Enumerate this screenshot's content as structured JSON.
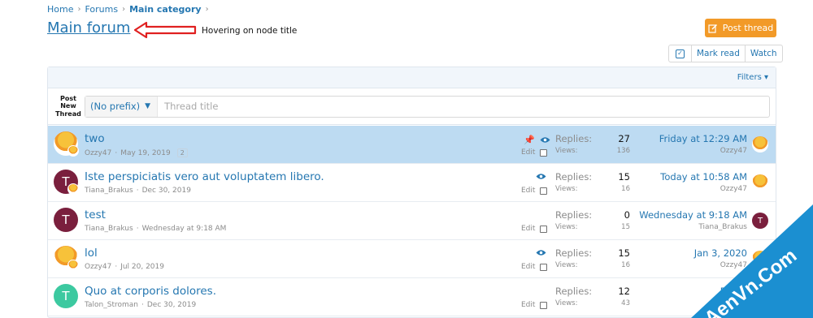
{
  "breadcrumb": {
    "items": [
      "Home",
      "Forums",
      "Main category"
    ]
  },
  "title": "Main forum",
  "annotation": "Hovering on node title",
  "post_thread": "Post thread",
  "actions": {
    "mark_read": "Mark read",
    "watch": "Watch"
  },
  "filters": "Filters",
  "new_thread": {
    "label_line1": "Post New",
    "label_line2": "Thread",
    "prefix": "(No prefix)",
    "placeholder": "Thread title"
  },
  "threads": [
    {
      "title": "two",
      "author": "Ozzy47",
      "date": "May 19, 2019",
      "pages": "2",
      "replies": "27",
      "views": "136",
      "last_date": "Friday at 12:29 AM",
      "last_user": "Ozzy47",
      "edit": "Edit"
    },
    {
      "title": "Iste perspiciatis vero aut voluptatem libero.",
      "author": "Tiana_Brakus",
      "date": "Dec 30, 2019",
      "replies": "15",
      "views": "16",
      "last_date": "Today at 10:58 AM",
      "last_user": "Ozzy47",
      "edit": "Edit"
    },
    {
      "title": "test",
      "author": "Tiana_Brakus",
      "date": "Wednesday at 9:18 AM",
      "replies": "0",
      "views": "15",
      "last_date": "Wednesday at 9:18 AM",
      "last_user": "Tiana_Brakus",
      "edit": "Edit"
    },
    {
      "title": "lol",
      "author": "Ozzy47",
      "date": "Jul 20, 2019",
      "replies": "15",
      "views": "16",
      "last_date": "Jan 3, 2020",
      "last_user": "Ozzy47",
      "edit": "Edit"
    },
    {
      "title": "Quo at corporis dolores.",
      "author": "Talon_Stroman",
      "date": "Dec 30, 2019",
      "replies": "12",
      "views": "43",
      "last_date": "Dec 3",
      "last_user": "Lail",
      "edit": "Edit"
    }
  ],
  "labels": {
    "replies": "Replies:",
    "views": "Views:"
  },
  "avatar_letters": {
    "t": "T"
  },
  "watermark": "AenVn.Com",
  "colors": {
    "accent": "#2577b1",
    "orange": "#f29a28",
    "highlight": "#bddbf2",
    "maroon": "#7a1f3d",
    "teal": "#3cc9a0",
    "arrow": "#e02020"
  }
}
